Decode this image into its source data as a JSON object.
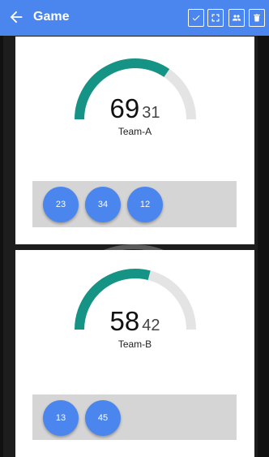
{
  "appbar": {
    "title": "Game",
    "back_icon": "arrow-back-icon",
    "actions": [
      {
        "icon": "check-icon"
      },
      {
        "icon": "fullscreen-icon"
      },
      {
        "icon": "people-icon"
      },
      {
        "icon": "delete-icon"
      }
    ]
  },
  "teams": [
    {
      "name": "Team-A",
      "score": "69",
      "opponent_score": "31",
      "progress": 0.69,
      "players": [
        "23",
        "34",
        "12"
      ]
    },
    {
      "name": "Team-B",
      "score": "58",
      "opponent_score": "42",
      "progress": 0.58,
      "players": [
        "13",
        "45"
      ]
    }
  ],
  "colors": {
    "appbar": "#4a86ee",
    "gauge_fill": "#159486",
    "gauge_track": "#e4e4e4",
    "chip": "#4a86ee",
    "tray": "#d5d5d5"
  }
}
